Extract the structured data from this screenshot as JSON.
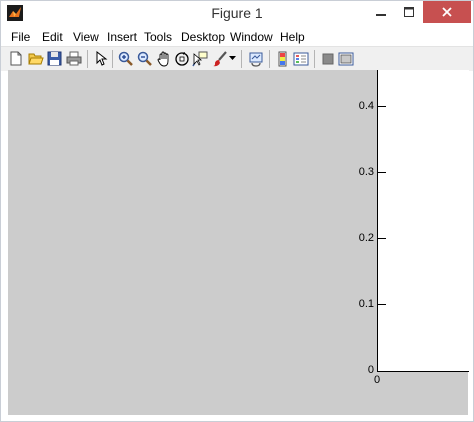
{
  "window": {
    "title": "Figure 1"
  },
  "menu": [
    "File",
    "Edit",
    "View",
    "Insert",
    "Tools",
    "Desktop",
    "Window",
    "Help"
  ],
  "toolbar": {
    "icons": [
      "new-figure-icon",
      "open-file-icon",
      "save-icon",
      "print-icon",
      "pointer-icon",
      "zoom-in-icon",
      "zoom-out-icon",
      "pan-icon",
      "rotate-3d-icon",
      "data-cursor-icon",
      "brush-icon",
      "link-plot-icon",
      "colorbar-icon",
      "legend-icon",
      "hide-plot-tools-icon",
      "show-plot-tools-icon"
    ]
  },
  "axes": {
    "yticks": [
      "0.4",
      "0.3",
      "0.2",
      "0.1",
      "0"
    ],
    "xticks": [
      "0"
    ]
  },
  "colors": {
    "figure_bg": "#cccccc",
    "close_button": "#c75050"
  }
}
